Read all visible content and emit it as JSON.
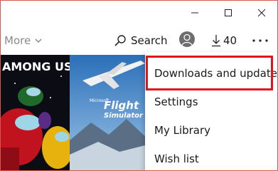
{
  "toolbar": {
    "more_label": "More",
    "search_label": "Search",
    "downloads_count": "40"
  },
  "tiles": {
    "game1_title": "AMONG US",
    "game2_title": "Flight",
    "game2_subtitle": "Simulator",
    "game2_brand": "Microsoft"
  },
  "menu": {
    "items": [
      {
        "label": "Downloads and updates"
      },
      {
        "label": "Settings"
      },
      {
        "label": "My Library"
      },
      {
        "label": "Wish list"
      }
    ]
  },
  "colors": {
    "highlight": "#e1141a",
    "frame_border": "#d4594f"
  }
}
